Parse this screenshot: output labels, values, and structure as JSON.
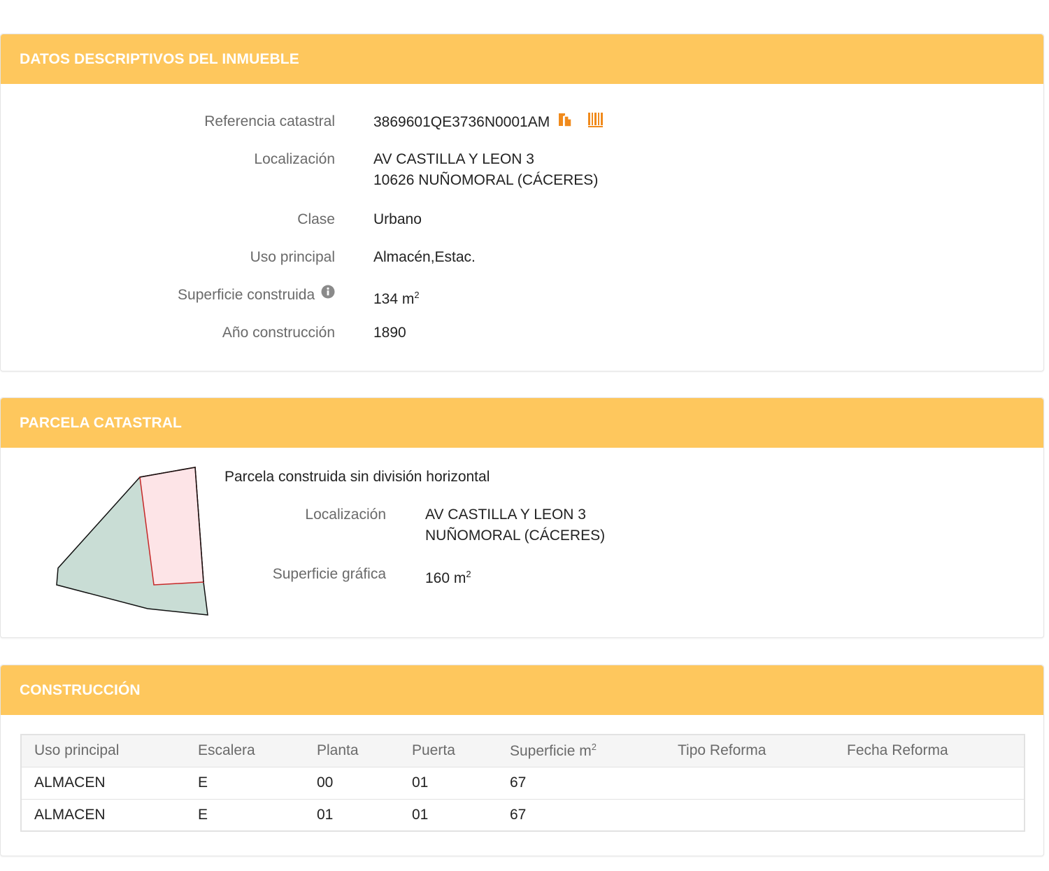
{
  "datos": {
    "title": "DATOS DESCRIPTIVOS DEL INMUEBLE",
    "labels": {
      "referencia": "Referencia catastral",
      "localizacion": "Localización",
      "clase": "Clase",
      "uso": "Uso principal",
      "superficie": "Superficie construida",
      "anio": "Año construcción"
    },
    "values": {
      "referencia": "3869601QE3736N0001AM",
      "localizacion_line1": "AV CASTILLA Y LEON 3",
      "localizacion_line2": "10626 NUÑOMORAL (CÁCERES)",
      "clase": "Urbano",
      "uso": "Almacén,Estac.",
      "superficie": "134 m",
      "superficie_unit_exp": "2",
      "anio": "1890"
    },
    "icons": [
      "copy-icon",
      "barcode-icon",
      "info-icon"
    ]
  },
  "parcela": {
    "title": "PARCELA CATASTRAL",
    "subtitle": "Parcela construida sin división horizontal",
    "labels": {
      "localizacion": "Localización",
      "superficie": "Superficie gráfica"
    },
    "values": {
      "localizacion_line1": "AV CASTILLA Y LEON 3",
      "localizacion_line2": "NUÑOMORAL (CÁCERES)",
      "superficie": "160 m",
      "superficie_unit_exp": "2"
    },
    "colors": {
      "parcel_fill": "#c9ddd5",
      "building_fill": "#fde4e7",
      "building_stroke": "#c62828"
    }
  },
  "construccion": {
    "title": "CONSTRUCCIÓN",
    "columns": [
      "Uso principal",
      "Escalera",
      "Planta",
      "Puerta",
      "Superficie m",
      "Tipo Reforma",
      "Fecha Reforma"
    ],
    "superficie_unit_exp": "2",
    "rows": [
      [
        "ALMACEN",
        "E",
        "00",
        "01",
        "67",
        "",
        ""
      ],
      [
        "ALMACEN",
        "E",
        "01",
        "01",
        "67",
        "",
        ""
      ]
    ]
  },
  "colors": {
    "header_bg": "#fec75d",
    "accent_icon": "#f08a1c"
  }
}
